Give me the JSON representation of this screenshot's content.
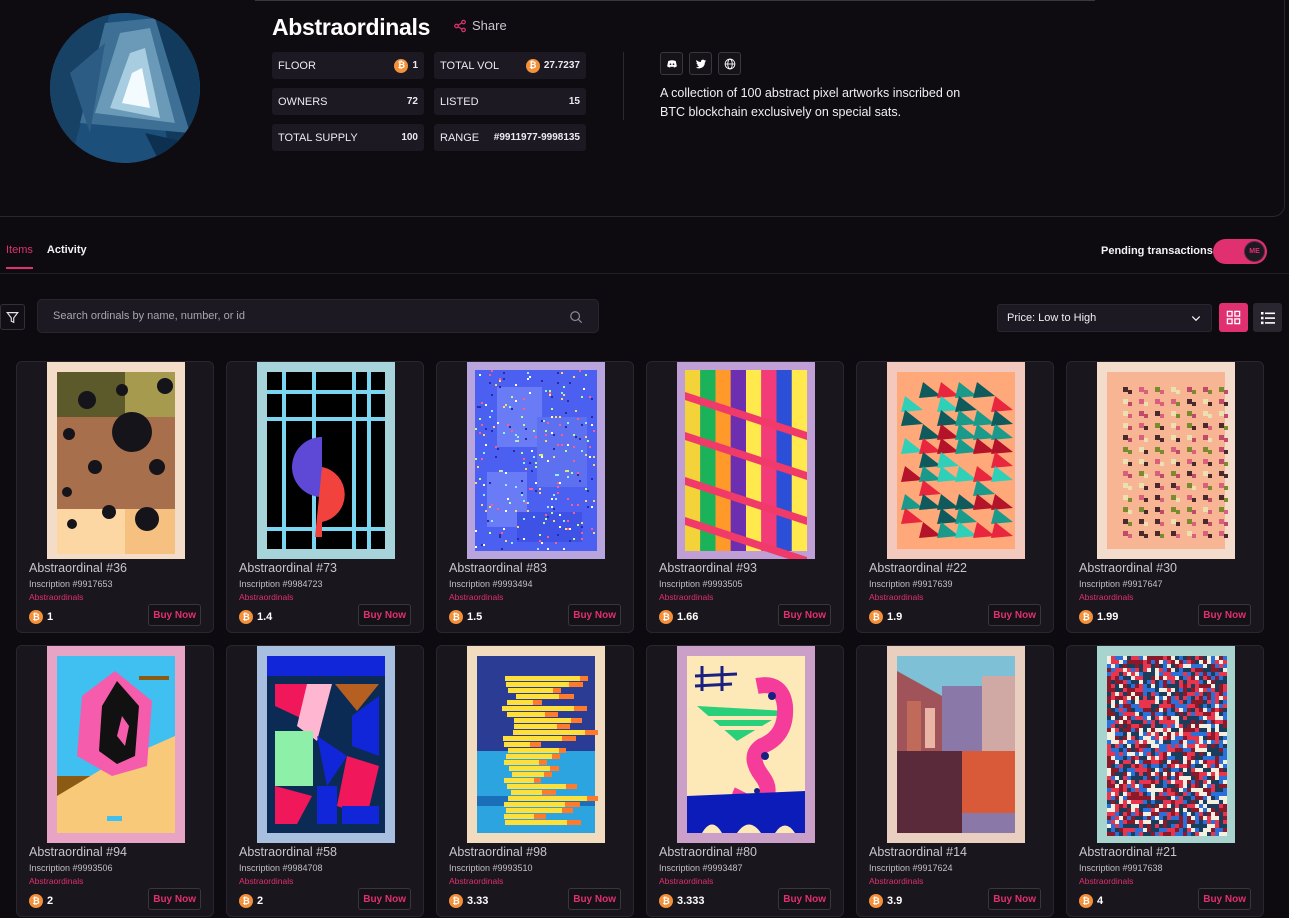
{
  "collection": {
    "title": "Abstraordinals",
    "share_label": "Share",
    "description": "A collection of 100 abstract pixel artworks inscribed on BTC blockchain exclusively on special sats.",
    "stats": {
      "floor_label": "FLOOR",
      "floor_value": "1",
      "total_vol_label": "TOTAL VOL",
      "total_vol_value": "27.7237",
      "owners_label": "OWNERS",
      "owners_value": "72",
      "listed_label": "LISTED",
      "listed_value": "15",
      "total_supply_label": "TOTAL SUPPLY",
      "total_supply_value": "100",
      "range_label": "RANGE",
      "range_value": "#9911977-9998135"
    },
    "socials": [
      "discord-icon",
      "twitter-icon",
      "globe-icon"
    ]
  },
  "tabs": {
    "items": "Items",
    "activity": "Activity"
  },
  "pending": {
    "label": "Pending transactions",
    "enabled": true,
    "knob_text": "ME"
  },
  "search": {
    "placeholder": "Search ordinals by name, number, or id"
  },
  "sort": {
    "selected": "Price: Low to High"
  },
  "colors": {
    "accent": "#e0306f",
    "btc": "#f4903a",
    "background": "#0d0b0f",
    "card": "#19161d"
  },
  "cards": [
    {
      "name": "Abstraordinal #36",
      "inscription": "Inscription #9917653",
      "collection": "Abstraordinals",
      "price": "1",
      "buy": "Buy Now",
      "art": "dots"
    },
    {
      "name": "Abstraordinal #73",
      "inscription": "Inscription #9984723",
      "collection": "Abstraordinals",
      "price": "1.4",
      "buy": "Buy Now",
      "art": "grid"
    },
    {
      "name": "Abstraordinal #83",
      "inscription": "Inscription #9993494",
      "collection": "Abstraordinals",
      "price": "1.5",
      "buy": "Buy Now",
      "art": "blue"
    },
    {
      "name": "Abstraordinal #93",
      "inscription": "Inscription #9993505",
      "collection": "Abstraordinals",
      "price": "1.66",
      "buy": "Buy Now",
      "art": "stripes"
    },
    {
      "name": "Abstraordinal #22",
      "inscription": "Inscription #9917639",
      "collection": "Abstraordinals",
      "price": "1.9",
      "buy": "Buy Now",
      "art": "triangles"
    },
    {
      "name": "Abstraordinal #30",
      "inscription": "Inscription #9917647",
      "collection": "Abstraordinals",
      "price": "1.99",
      "buy": "Buy Now",
      "art": "confetti"
    },
    {
      "name": "Abstraordinal #94",
      "inscription": "Inscription #9993506",
      "collection": "Abstraordinals",
      "price": "2",
      "buy": "Buy Now",
      "art": "hexagon"
    },
    {
      "name": "Abstraordinal #58",
      "inscription": "Inscription #9984708",
      "collection": "Abstraordinals",
      "price": "2",
      "buy": "Buy Now",
      "art": "tangram"
    },
    {
      "name": "Abstraordinal #98",
      "inscription": "Inscription #9993510",
      "collection": "Abstraordinals",
      "price": "3.33",
      "buy": "Buy Now",
      "art": "glitch"
    },
    {
      "name": "Abstraordinal #80",
      "inscription": "Inscription #9993487",
      "collection": "Abstraordinals",
      "price": "3.333",
      "buy": "Buy Now",
      "art": "seahorse"
    },
    {
      "name": "Abstraordinal #14",
      "inscription": "Inscription #9917624",
      "collection": "Abstraordinals",
      "price": "3.9",
      "buy": "Buy Now",
      "art": "city"
    },
    {
      "name": "Abstraordinal #21",
      "inscription": "Inscription #9917638",
      "collection": "Abstraordinals",
      "price": "4",
      "buy": "Buy Now",
      "art": "pattern"
    }
  ]
}
